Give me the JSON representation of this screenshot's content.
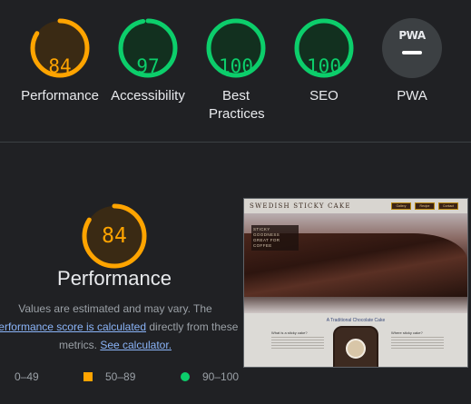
{
  "colors": {
    "background": "#202124",
    "pass": "#0cce6b",
    "average": "#ffa400",
    "fail": "#ff4e42",
    "link": "#8ab4f8"
  },
  "gauges": [
    {
      "label": "Performance",
      "score": "84",
      "value": 84,
      "rating": "average"
    },
    {
      "label": "Accessibility",
      "score": "97",
      "value": 97,
      "rating": "pass"
    },
    {
      "label": "Best Practices",
      "score": "100",
      "value": 100,
      "rating": "pass"
    },
    {
      "label": "SEO",
      "score": "100",
      "value": 100,
      "rating": "pass"
    },
    {
      "label": "PWA",
      "badge_text": "PWA",
      "icon": "pwa-dash-icon"
    }
  ],
  "detail": {
    "score": "84",
    "value": 84,
    "title": "Performance",
    "note_prefix": "Values are estimated and may vary. The",
    "note_link": "performance score is calculated",
    "note_middle": "directly from these metrics.",
    "note_link2": "See calculator.",
    "legend": [
      {
        "range": "0–49",
        "icon": "triangle-fail-icon"
      },
      {
        "range": "50–89",
        "icon": "square-average-icon"
      },
      {
        "range": "90–100",
        "icon": "circle-pass-icon"
      }
    ]
  },
  "screenshot": {
    "brand": "SWEDISH STICKY CAKE",
    "nav": [
      "Gallery",
      "Recipe",
      "Contact"
    ],
    "hero_lines": [
      "STICKY GOODNESS",
      "GREAT FOR COFFEE"
    ],
    "subtitle": "A Traditional Chocolate Cake",
    "col_left_title": "What is a sticky cake?",
    "col_right_title": "Where sticky cake?"
  }
}
